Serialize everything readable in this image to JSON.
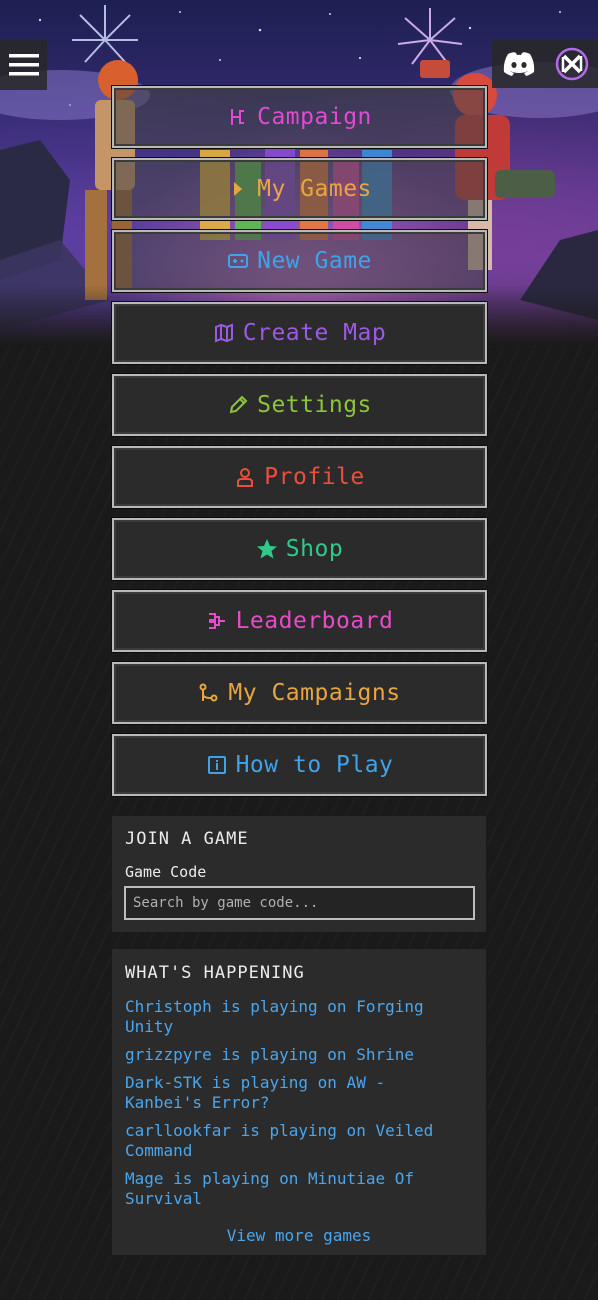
{
  "header": {
    "menu_icon": "hamburger-icon",
    "social": [
      {
        "name": "discord",
        "icon": "discord-icon"
      },
      {
        "name": "app-logo",
        "icon": "x-logo-icon"
      }
    ]
  },
  "menu": [
    {
      "label": "Campaign",
      "icon": "campaign-icon",
      "color": "#e04bd0"
    },
    {
      "label": "My Games",
      "icon": "caret-right-icon",
      "color": "#e9a640"
    },
    {
      "label": "New Game",
      "icon": "gamepad-icon",
      "color": "#3fa3ec"
    },
    {
      "label": "Create Map",
      "icon": "map-icon",
      "color": "#9a5ae6"
    },
    {
      "label": "Settings",
      "icon": "pencil-icon",
      "color": "#8dc43a"
    },
    {
      "label": "Profile",
      "icon": "user-icon",
      "color": "#ec4e3c"
    },
    {
      "label": "Shop",
      "icon": "star-icon",
      "color": "#2fca8a"
    },
    {
      "label": "Leaderboard",
      "icon": "bracket-icon",
      "color": "#e64bc8"
    },
    {
      "label": "My Campaigns",
      "icon": "branch-icon",
      "color": "#e9a640"
    },
    {
      "label": "How to Play",
      "icon": "info-icon",
      "color": "#3fa3ec"
    }
  ],
  "join": {
    "title": "JOIN A GAME",
    "label": "Game Code",
    "placeholder": "Search by game code..."
  },
  "news": {
    "title": "WHAT'S HAPPENING",
    "items": [
      "Christoph is playing on Forging Unity",
      "grizzpyre is playing on Shrine",
      "Dark-STK is playing on AW - Kanbei's Error?",
      "carllookfar is playing on Veiled Command",
      "Mage is playing on Minutiae Of Survival"
    ],
    "view_more": "View more games"
  }
}
